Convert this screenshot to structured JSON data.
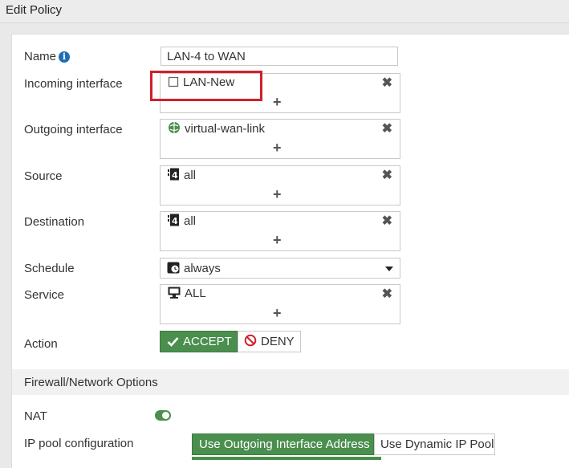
{
  "header": {
    "title": "Edit Policy"
  },
  "form": {
    "name": {
      "label": "Name",
      "value": "LAN-4 to WAN"
    },
    "incoming": {
      "label": "Incoming interface",
      "entry": "LAN-New",
      "add": "+",
      "remove": "✖"
    },
    "outgoing": {
      "label": "Outgoing interface",
      "entry": "virtual-wan-link",
      "add": "+",
      "remove": "✖"
    },
    "source": {
      "label": "Source",
      "entry": "all",
      "add": "+",
      "remove": "✖"
    },
    "destination": {
      "label": "Destination",
      "entry": "all",
      "add": "+",
      "remove": "✖"
    },
    "schedule": {
      "label": "Schedule",
      "value": "always"
    },
    "service": {
      "label": "Service",
      "entry": "ALL",
      "add": "+",
      "remove": "✖"
    },
    "action": {
      "label": "Action",
      "accept": "ACCEPT",
      "deny": "DENY",
      "selected": "ACCEPT"
    }
  },
  "firewall": {
    "section_title": "Firewall/Network Options",
    "nat": {
      "label": "NAT",
      "enabled": true
    },
    "ip_pool": {
      "label": "IP pool configuration",
      "option_outgoing": "Use Outgoing Interface Address",
      "option_dynamic": "Use Dynamic IP Pool",
      "selected": "Use Outgoing Interface Address"
    }
  },
  "colors": {
    "accent": "#4a8f4e",
    "highlight": "#d0202a",
    "info": "#1f6fb2"
  }
}
